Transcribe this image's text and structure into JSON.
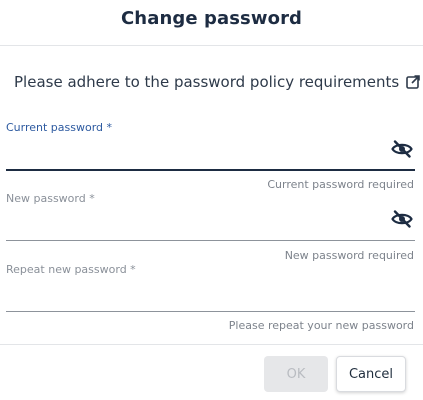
{
  "dialog": {
    "title": "Change password",
    "policy_text": "Please adhere to the password policy requirements",
    "policy_icon": "external-link-icon"
  },
  "fields": {
    "current": {
      "label": "Current password *",
      "value": "",
      "helper": "Current password required",
      "icon": "eye-off-icon",
      "focused": true
    },
    "new": {
      "label": "New password *",
      "value": "",
      "helper": "New password required",
      "icon": "eye-off-icon",
      "focused": false
    },
    "repeat": {
      "label": "Repeat new password *",
      "value": "",
      "helper": "Please repeat your new password",
      "focused": false
    }
  },
  "actions": {
    "ok_label": "OK",
    "ok_disabled": true,
    "cancel_label": "Cancel"
  },
  "colors": {
    "title": "#1d2c42",
    "focus_label": "#2d5aa0",
    "active_underline": "#1d2c42",
    "disabled_button_bg": "#e6e7e9"
  }
}
